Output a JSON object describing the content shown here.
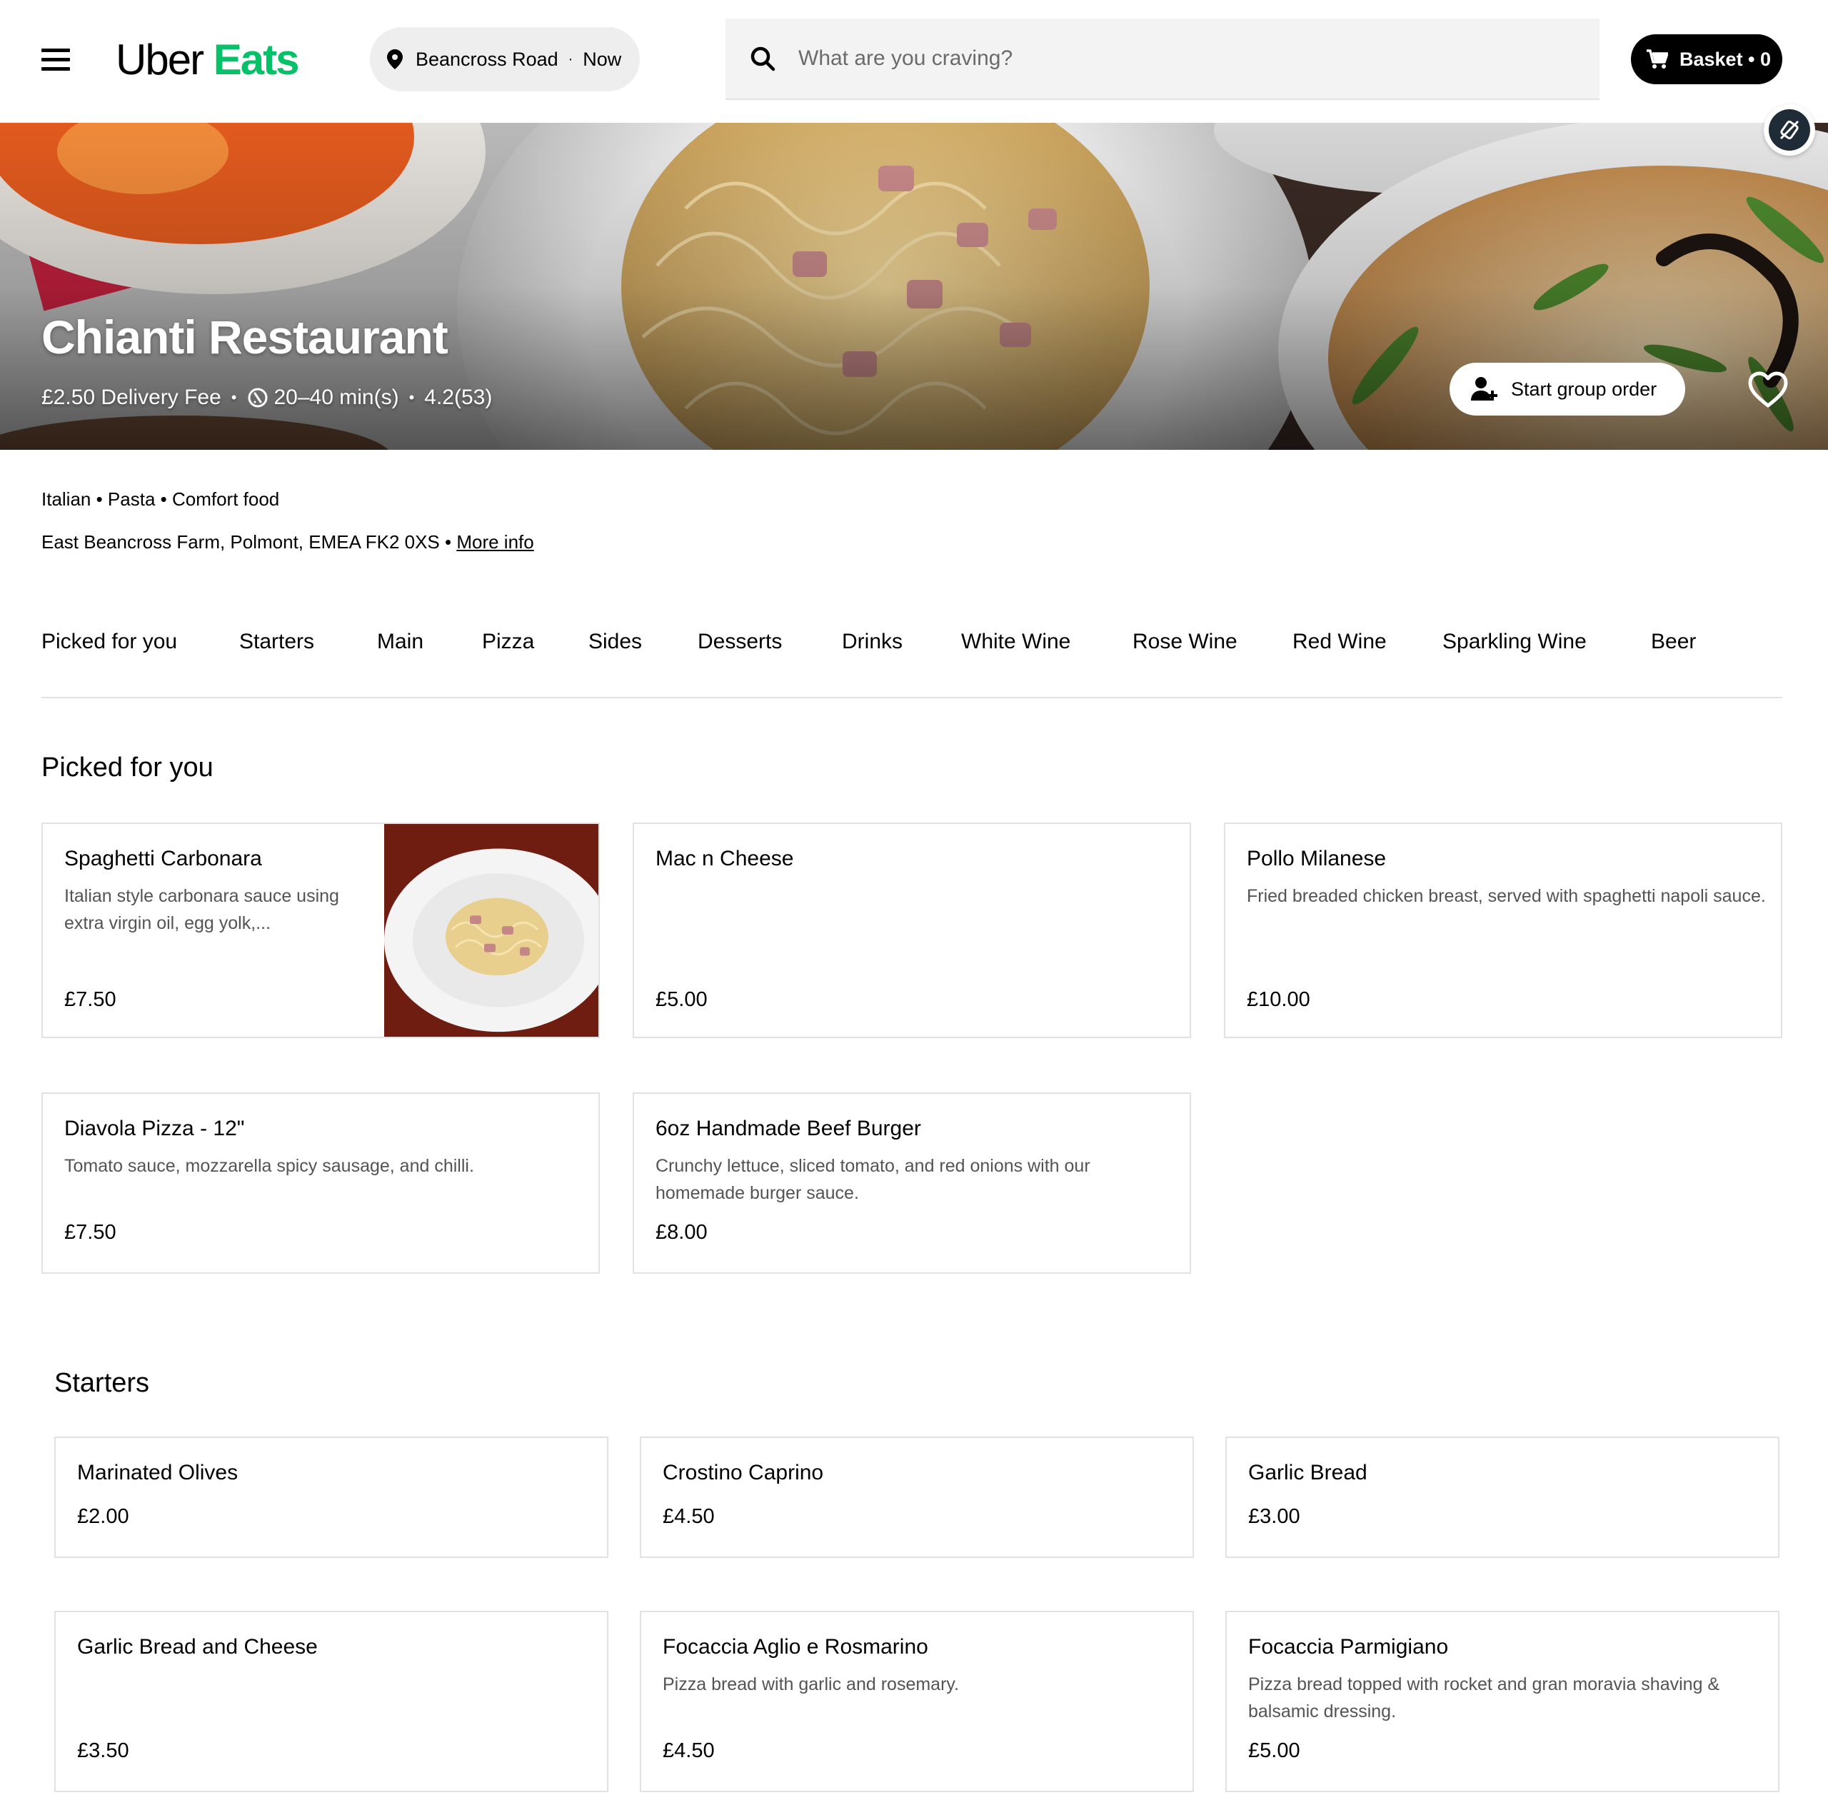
{
  "header": {
    "logo_part1": "Uber",
    "logo_part2": "Eats",
    "location": "Beancross Road",
    "time": "Now",
    "search_placeholder": "What are you craving?",
    "basket_label": "Basket • 0"
  },
  "colors": {
    "brand_green": "#06c167",
    "basket_bg": "#000000",
    "search_bg": "#f3f3f3",
    "card_border": "#e2e2e2"
  },
  "icons": [
    "menu-icon",
    "location-pin-icon",
    "search-icon",
    "cart-icon",
    "hide-icon",
    "clock-icon",
    "add-person-icon",
    "heart-icon"
  ],
  "restaurant": {
    "name": "Chianti Restaurant",
    "delivery_fee": "£2.50 Delivery Fee",
    "eta": "20–40 min(s)",
    "rating": "4.2",
    "rating_count": "(53)",
    "group_order_label": "Start group order",
    "cuisines": "Italian • Pasta • Comfort food",
    "address": "East Beancross Farm, Polmont, EMEA FK2 0XS •",
    "more_info": "More info"
  },
  "categories": [
    "Picked for you",
    "Starters",
    "Main",
    "Pizza",
    "Sides",
    "Desserts",
    "Drinks",
    "White Wine",
    "Rose Wine",
    "Red Wine",
    "Sparkling Wine",
    "Beer"
  ],
  "picked": {
    "title": "Picked for you",
    "items": [
      {
        "name": "Spaghetti Carbonara",
        "desc": "Italian style carbonara sauce using extra virgin oil, egg yolk,...",
        "price": "£7.50"
      },
      {
        "name": "Mac n Cheese",
        "desc": "",
        "price": "£5.00"
      },
      {
        "name": "Pollo Milanese",
        "desc": "Fried breaded chicken breast, served with spaghetti napoli sauce.",
        "price": "£10.00"
      },
      {
        "name": "Diavola Pizza - 12\"",
        "desc": "Tomato sauce, mozzarella spicy sausage, and chilli.",
        "price": "£7.50"
      },
      {
        "name": "6oz Handmade Beef Burger",
        "desc": "Crunchy lettuce, sliced tomato, and red onions with our homemade burger sauce.",
        "price": "£8.00"
      }
    ]
  },
  "starters": {
    "title": "Starters",
    "items": [
      {
        "name": "Marinated Olives",
        "desc": "",
        "price": "£2.00"
      },
      {
        "name": "Crostino Caprino",
        "desc": "",
        "price": "£4.50"
      },
      {
        "name": "Garlic Bread",
        "desc": "",
        "price": "£3.00"
      },
      {
        "name": "Garlic Bread and Cheese",
        "desc": "",
        "price": "£3.50"
      },
      {
        "name": "Focaccia Aglio e Rosmarino",
        "desc": "Pizza bread with garlic and rosemary.",
        "price": "£4.50"
      },
      {
        "name": "Focaccia Parmigiano",
        "desc": "Pizza bread topped with rocket and gran moravia shaving & balsamic dressing.",
        "price": "£5.00"
      }
    ]
  }
}
